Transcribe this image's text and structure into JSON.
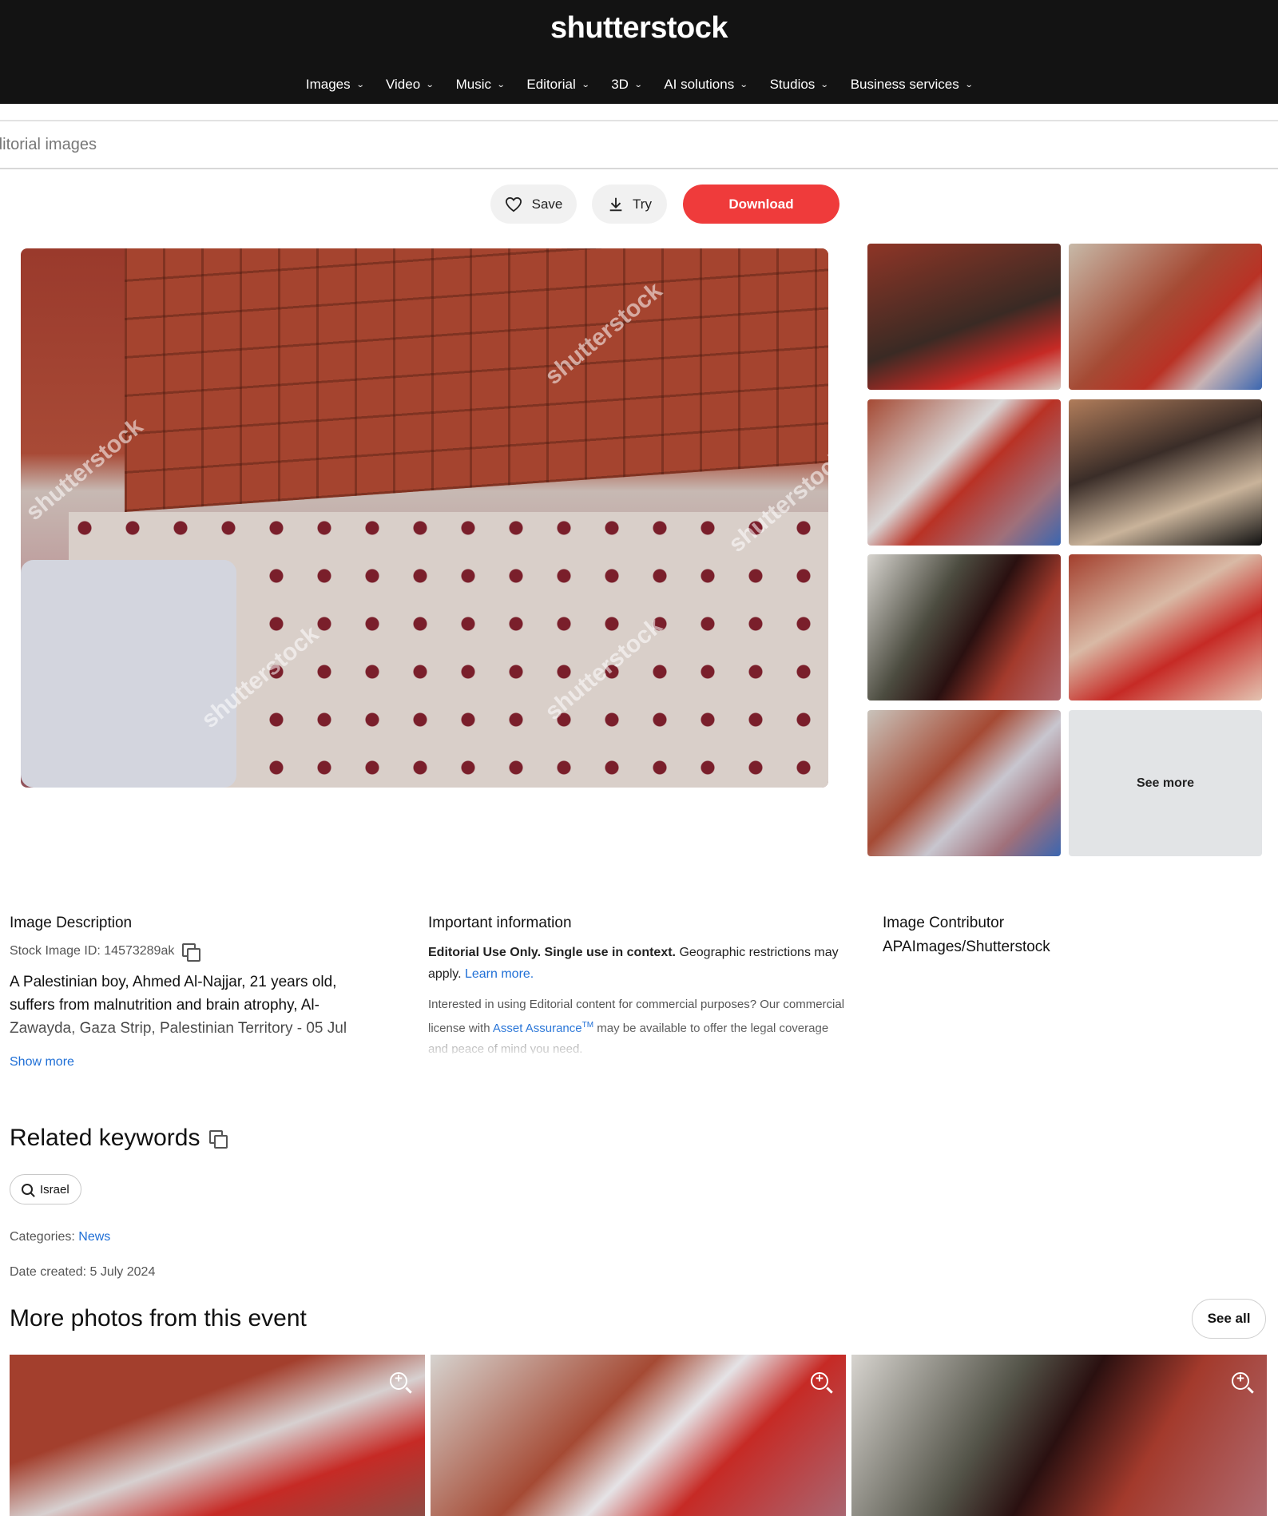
{
  "header": {
    "logo": "shutterstock",
    "nav": [
      {
        "label": "Images"
      },
      {
        "label": "Video"
      },
      {
        "label": "Music"
      },
      {
        "label": "Editorial"
      },
      {
        "label": "3D"
      },
      {
        "label": "AI solutions"
      },
      {
        "label": "Studios"
      },
      {
        "label": "Business services"
      }
    ]
  },
  "search": {
    "placeholder": "ditorial images"
  },
  "actions": {
    "save": "Save",
    "try": "Try",
    "download": "Download"
  },
  "main_image": {
    "watermark": "shutterstock"
  },
  "thumbnails": {
    "see_more": "See more"
  },
  "description": {
    "heading": "Image Description",
    "stock_id": "Stock Image ID: 14573289ak",
    "text": "A Palestinian boy, Ahmed Al-Najjar, 21 years old, suffers from malnutrition and brain atrophy, Al-Zawayda, Gaza Strip, Palestinian Territory - 05 Jul",
    "show_more": "Show more"
  },
  "important": {
    "heading": "Important information",
    "bold1": "Editorial Use Only",
    "bold2": "Single use in context",
    "geo": "Geographic restrictions may apply.",
    "learn_more": "Learn more.",
    "p2_before": "Interested in using Editorial content for commercial purposes? Our commercial license with",
    "asset_assurance": "Asset Assurance",
    "tm": "TM",
    "p2_after": "may be available to offer the legal coverage and peace of mind you need."
  },
  "contributor": {
    "heading": "Image Contributor",
    "name": "APAImages/Shutterstock"
  },
  "keywords": {
    "heading": "Related keywords",
    "items": [
      "Israel"
    ]
  },
  "categories": {
    "label": "Categories:",
    "value": "News"
  },
  "date_created": "Date created: 5 July 2024",
  "more_photos": {
    "heading": "More photos from this event",
    "see_all": "See all"
  }
}
